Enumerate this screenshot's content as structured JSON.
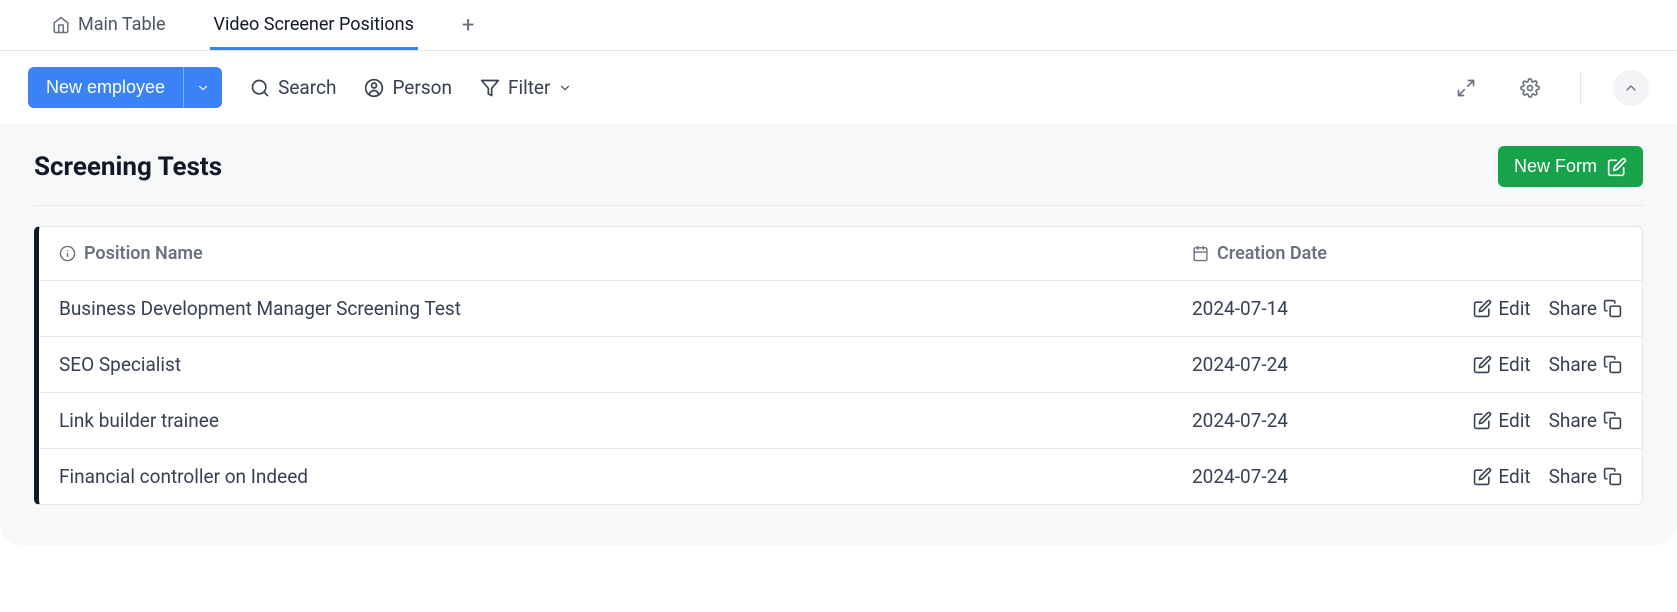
{
  "tabs": [
    {
      "label": "Main Table",
      "active": false
    },
    {
      "label": "Video Screener Positions",
      "active": true
    }
  ],
  "toolbar": {
    "new_employee": "New employee",
    "search": "Search",
    "person": "Person",
    "filter": "Filter"
  },
  "section": {
    "title": "Screening Tests",
    "new_form": "New Form"
  },
  "columns": {
    "position": "Position Name",
    "date": "Creation Date"
  },
  "actions": {
    "edit": "Edit",
    "share": "Share"
  },
  "rows": [
    {
      "name": "Business Development Manager Screening Test",
      "date": "2024-07-14"
    },
    {
      "name": "SEO Specialist",
      "date": "2024-07-24"
    },
    {
      "name": "Link builder trainee",
      "date": "2024-07-24"
    },
    {
      "name": "Financial controller on Indeed",
      "date": "2024-07-24"
    }
  ]
}
